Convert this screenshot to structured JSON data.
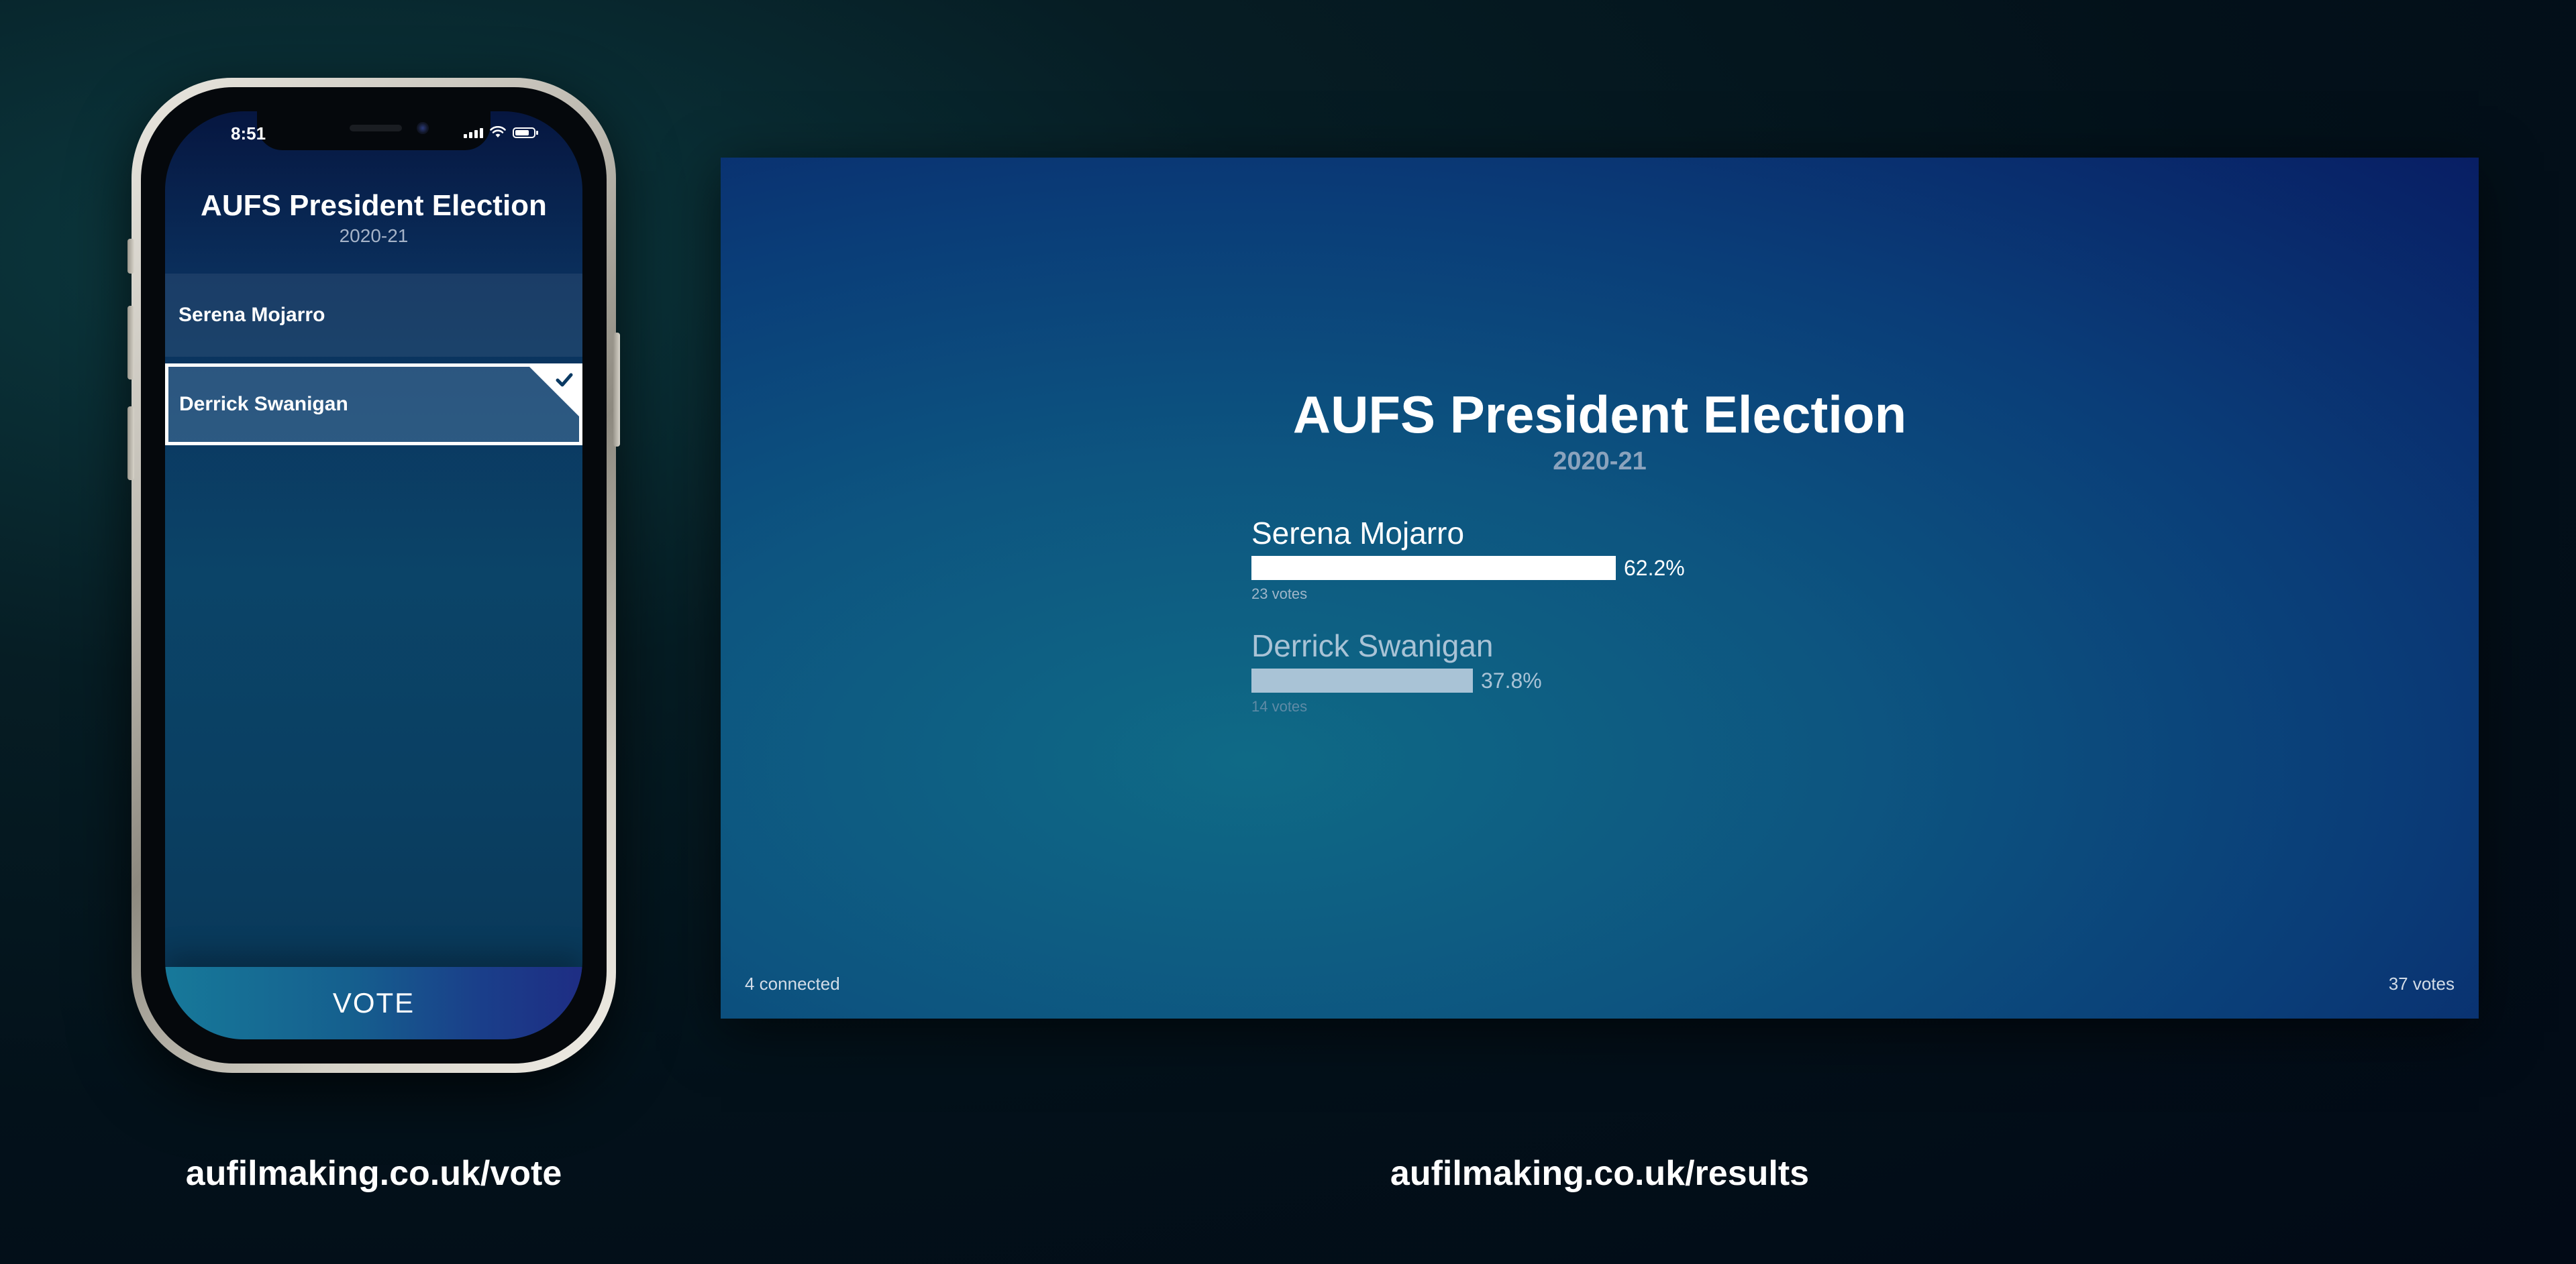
{
  "phone": {
    "status_time": "8:51",
    "title": "AUFS President Election",
    "subtitle": "2020-21",
    "candidates": [
      {
        "name": "Serena Mojarro",
        "selected": false
      },
      {
        "name": "Derrick Swanigan",
        "selected": true
      }
    ],
    "vote_button_label": "VOTE"
  },
  "results": {
    "title": "AUFS President Election",
    "subtitle": "2020-21",
    "candidates": [
      {
        "name": "Serena Mojarro",
        "percent_label": "62.2%",
        "percent": 62.2,
        "votes_label": "23 votes",
        "color": "#ffffff"
      },
      {
        "name": "Derrick Swanigan",
        "percent_label": "37.8%",
        "percent": 37.8,
        "votes_label": "14 votes",
        "color": "#a9c3d6"
      }
    ],
    "connected_label": "4 connected",
    "total_votes_label": "37 votes"
  },
  "urls": {
    "vote": "aufilmaking.co.uk/vote",
    "results": "aufilmaking.co.uk/results"
  },
  "colors": {
    "vote_button_start": "#17799a",
    "vote_button_end": "#1e2d84",
    "winner_bar": "#ffffff",
    "runner_up_bar": "#a9c3d6"
  }
}
